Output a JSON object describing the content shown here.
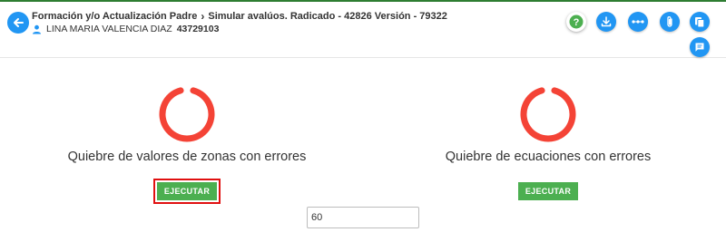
{
  "header": {
    "breadcrumb": [
      "Formación y/o Actualización Padre",
      "Simular avalúos. Radicado - 42826 Versión - 79322"
    ],
    "user_name": "LINA MARIA VALENCIA DIAZ",
    "user_id": "43729103"
  },
  "toolbar": {
    "icons": [
      "help-icon",
      "download-icon",
      "more-dots-icon",
      "attachment-icon",
      "copy-document-icon",
      "comment-icon"
    ],
    "colors": {
      "primary": "#2196f3",
      "help": "#4caf50"
    }
  },
  "panels": [
    {
      "title": "Quiebre de valores de zonas con errores",
      "button_label": "EJECUTAR",
      "highlighted": true
    },
    {
      "title": "Quiebre de ecuaciones con errores",
      "button_label": "EJECUTAR",
      "highlighted": false
    }
  ],
  "input": {
    "value": "60"
  },
  "colors": {
    "status_ring": "#f44336",
    "button": "#4caf50",
    "highlight": "#e01010",
    "accent_bar": "#2e7d32"
  }
}
